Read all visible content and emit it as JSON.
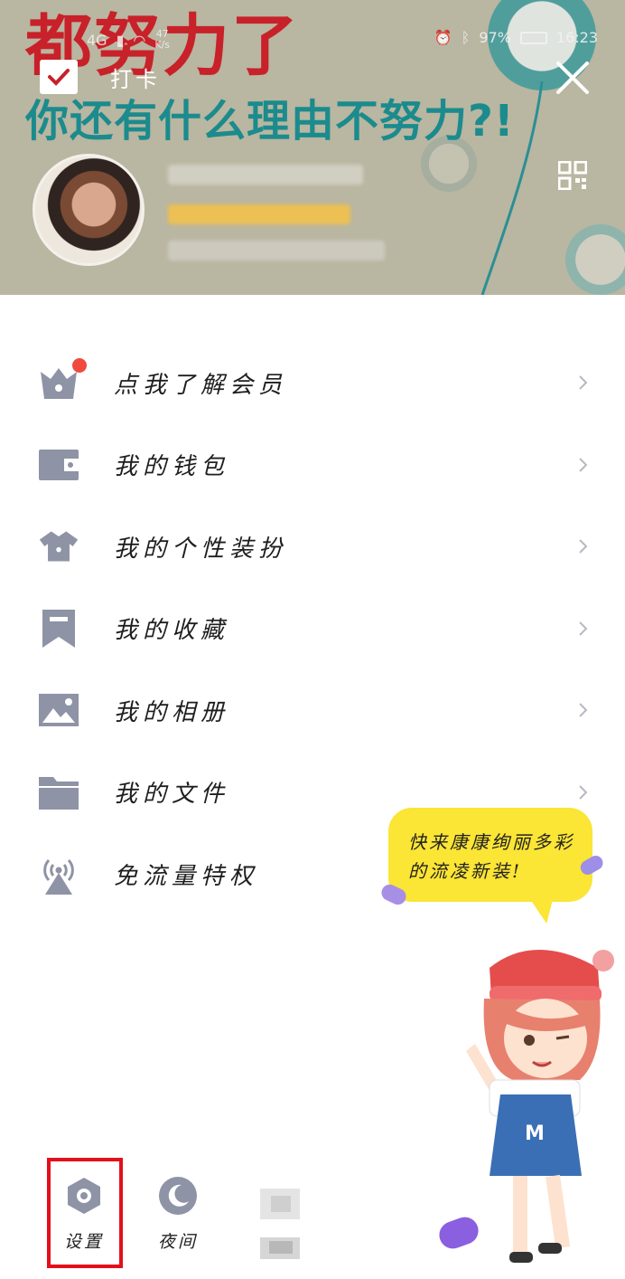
{
  "statusbar": {
    "network": "4G",
    "speed_value": "47",
    "speed_unit": "K/s",
    "battery": "97%",
    "time": "16:23"
  },
  "banner": {
    "headline_main": "都努力了",
    "headline_sub": "你还有什么理由不努力?!"
  },
  "header": {
    "checkin_label": "打卡"
  },
  "menu": {
    "items": [
      {
        "label": "点我了解会员",
        "icon": "vip-crown-icon",
        "badge": true
      },
      {
        "label": "我的钱包",
        "icon": "wallet-icon"
      },
      {
        "label": "我的个性装扮",
        "icon": "tshirt-icon"
      },
      {
        "label": "我的收藏",
        "icon": "bookmark-icon"
      },
      {
        "label": "我的相册",
        "icon": "photo-icon"
      },
      {
        "label": "我的文件",
        "icon": "folder-icon"
      },
      {
        "label": "免流量特权",
        "icon": "antenna-icon"
      }
    ]
  },
  "promo": {
    "bubble_text": "快来康康绚丽多彩的流凌新装!"
  },
  "bottom": {
    "settings_label": "设置",
    "night_label": "夜间"
  },
  "colors": {
    "icon_gray": "#8e93a6",
    "highlight_red": "#e3101a",
    "badge_red": "#f04a3e",
    "bubble_yellow": "#fbe535",
    "banner_bg": "#b9b6a1"
  }
}
